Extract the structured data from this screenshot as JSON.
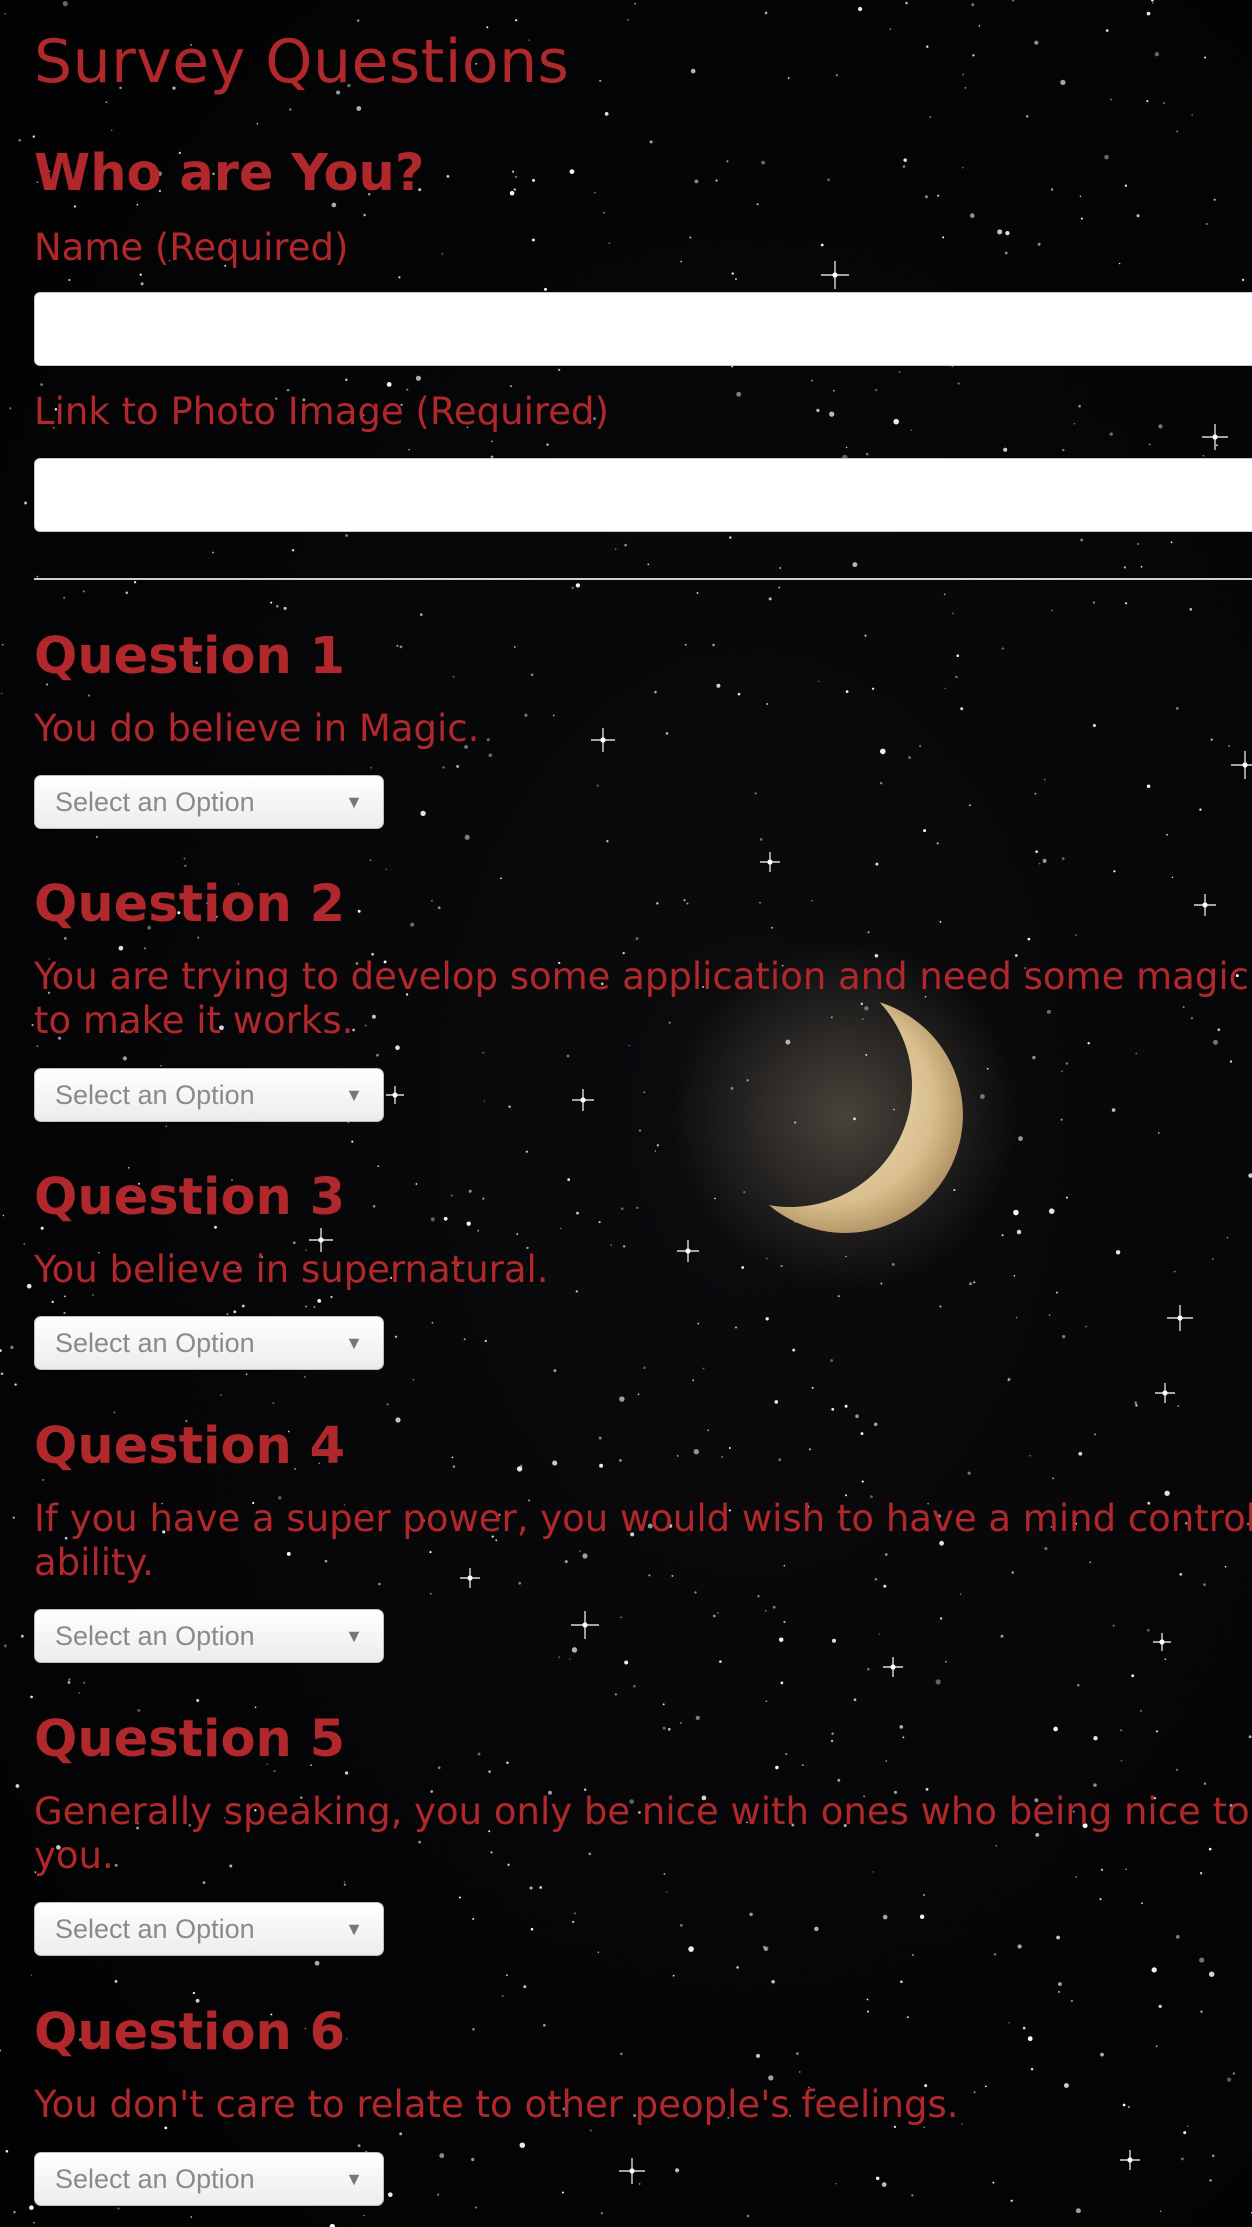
{
  "title": "Survey Questions",
  "identity": {
    "heading": "Who are You?",
    "name_label": "Name (Required)",
    "photo_label": "Link to Photo Image (Required)",
    "name_value": "",
    "photo_value": ""
  },
  "questions": [
    {
      "title": "Question 1",
      "text": "You do believe in Magic.",
      "select": "Select an Option"
    },
    {
      "title": "Question 2",
      "text": "You are trying to develop some application and need some magic to make it works.",
      "select": "Select an Option"
    },
    {
      "title": "Question 3",
      "text": "You believe in supernatural.",
      "select": "Select an Option"
    },
    {
      "title": "Question 4",
      "text": "If you have a super power, you would wish to have a mind control ability.",
      "select": "Select an Option"
    },
    {
      "title": "Question 5",
      "text": "Generally speaking, you only be nice with ones who being nice to you.",
      "select": "Select an Option"
    },
    {
      "title": "Question 6",
      "text": "You don't care to relate to other people's feelings.",
      "select": "Select an Option"
    }
  ],
  "colors": {
    "text": "#b0282c",
    "background": "#050507",
    "moon": "#e8d2a8"
  },
  "icons": {
    "select_arrow": "chevron-down-icon",
    "background": "starry-sky-moon"
  }
}
